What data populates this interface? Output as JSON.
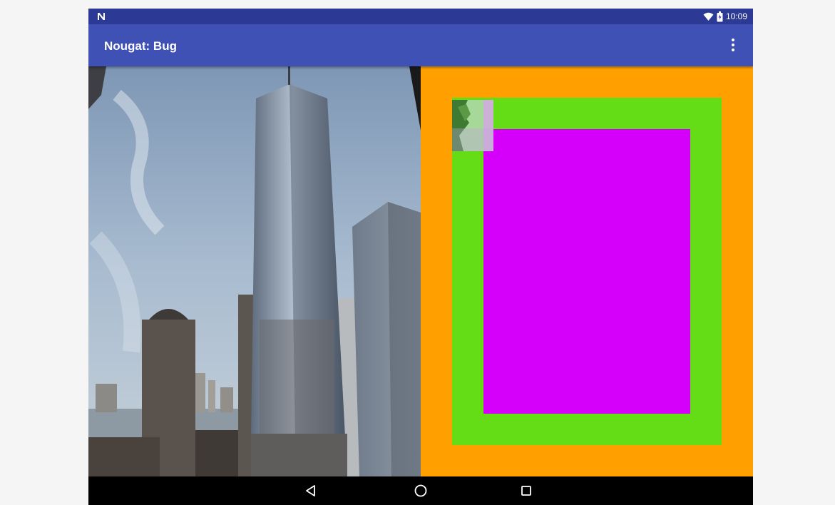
{
  "status_bar": {
    "notification_icon": "android-n-icon",
    "wifi_icon": "wifi-icon",
    "battery_icon": "battery-icon",
    "time": "10:09"
  },
  "app_bar": {
    "title": "Nougat: Bug",
    "overflow_icon": "more-vert-icon"
  },
  "content": {
    "left_image": "city-skyline-photo",
    "right_panel": {
      "outer_color": "#ffa000",
      "middle_color": "#64dd17",
      "inner_color": "#d500f9",
      "thumbnail": "tree-thumbnail"
    }
  },
  "nav_bar": {
    "back_icon": "back-triangle-icon",
    "home_icon": "home-circle-icon",
    "recents_icon": "recents-square-icon"
  },
  "colors": {
    "status_bar": "#2c3a95",
    "app_bar": "#3f51b5",
    "nav_bar": "#000000"
  }
}
